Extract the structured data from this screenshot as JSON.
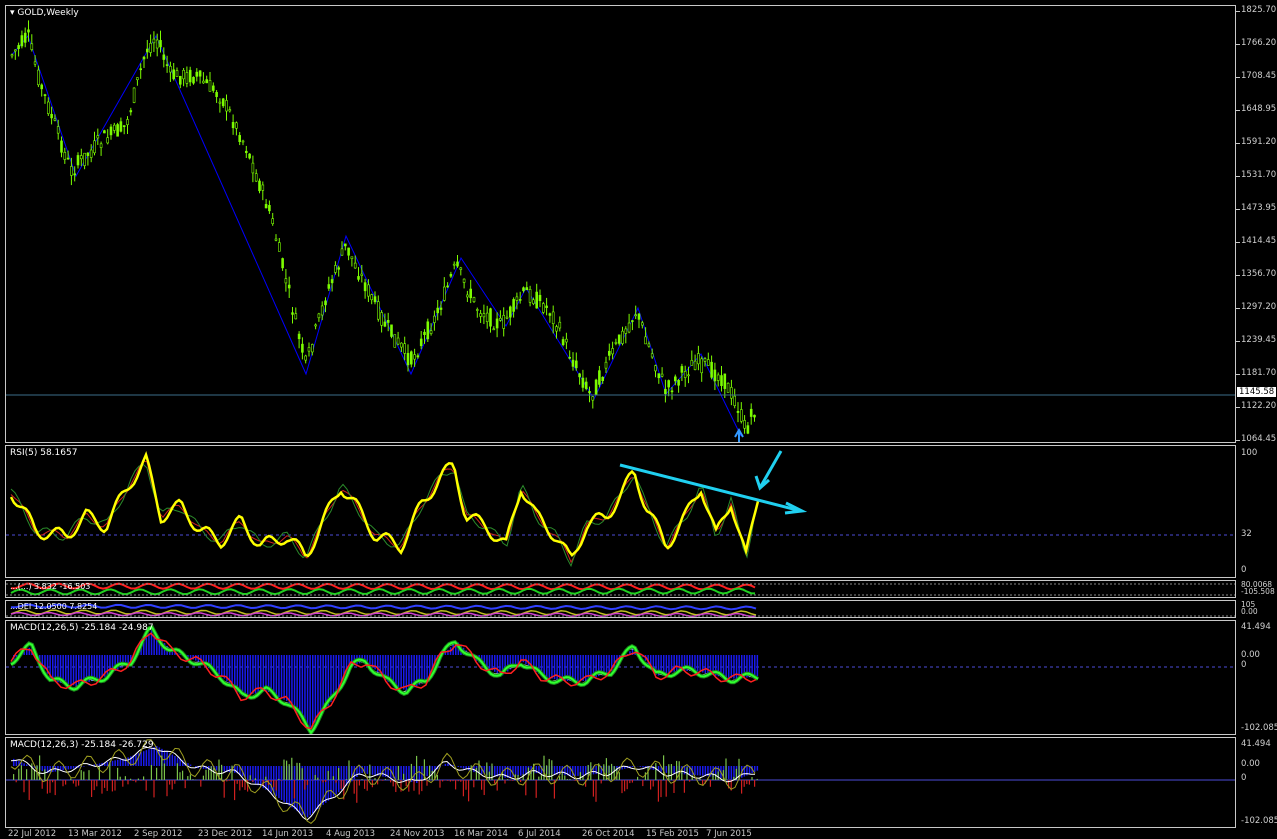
{
  "chart": {
    "symbol_label": "GOLD,Weekly",
    "price_ticks": [
      "1825.70",
      "1766.20",
      "1708.45",
      "1648.95",
      "1591.20",
      "1531.70",
      "1473.95",
      "1414.45",
      "1356.70",
      "1297.20",
      "1239.45",
      "1181.70",
      "1122.20",
      "1064.45"
    ],
    "current_price": "1145.58",
    "colors": {
      "bull": "#7cfc00",
      "bear": "#ffffff",
      "trend": "#0000ff"
    }
  },
  "rsi": {
    "label": "RSI(5) 58.1657",
    "ticks": [
      "100",
      "32",
      "0"
    ],
    "line_color": "#ffff00"
  },
  "ind2": {
    "label": "...(...) 3.832 -16.503",
    "ticks": [
      "80.0068",
      "-105.508"
    ]
  },
  "ind3": {
    "label": "...DEI 12.0500 7.8254",
    "ticks": [
      "105",
      "0.00"
    ]
  },
  "macd1": {
    "label": "MACD(12,26,5) -25.184 -24.987",
    "ticks": [
      "41.494",
      "0.00",
      "0",
      "-102.085"
    ]
  },
  "macd2": {
    "label": "MACD(12,26,3) -25.184 -26.729",
    "ticks": [
      "41.494",
      "0.00",
      "0",
      "-102.085"
    ]
  },
  "date_labels": [
    "22 Jul 2012",
    "13 Mar 2012",
    "2 Sep 2012",
    "23 Dec 2012",
    "14 Jun 2013",
    "4 Aug 2013",
    "24 Nov 2013",
    "16 Mar 2014",
    "6 Jul 2014",
    "26 Oct 2014",
    "15 Feb 2015",
    "7 Jun 2015"
  ]
}
